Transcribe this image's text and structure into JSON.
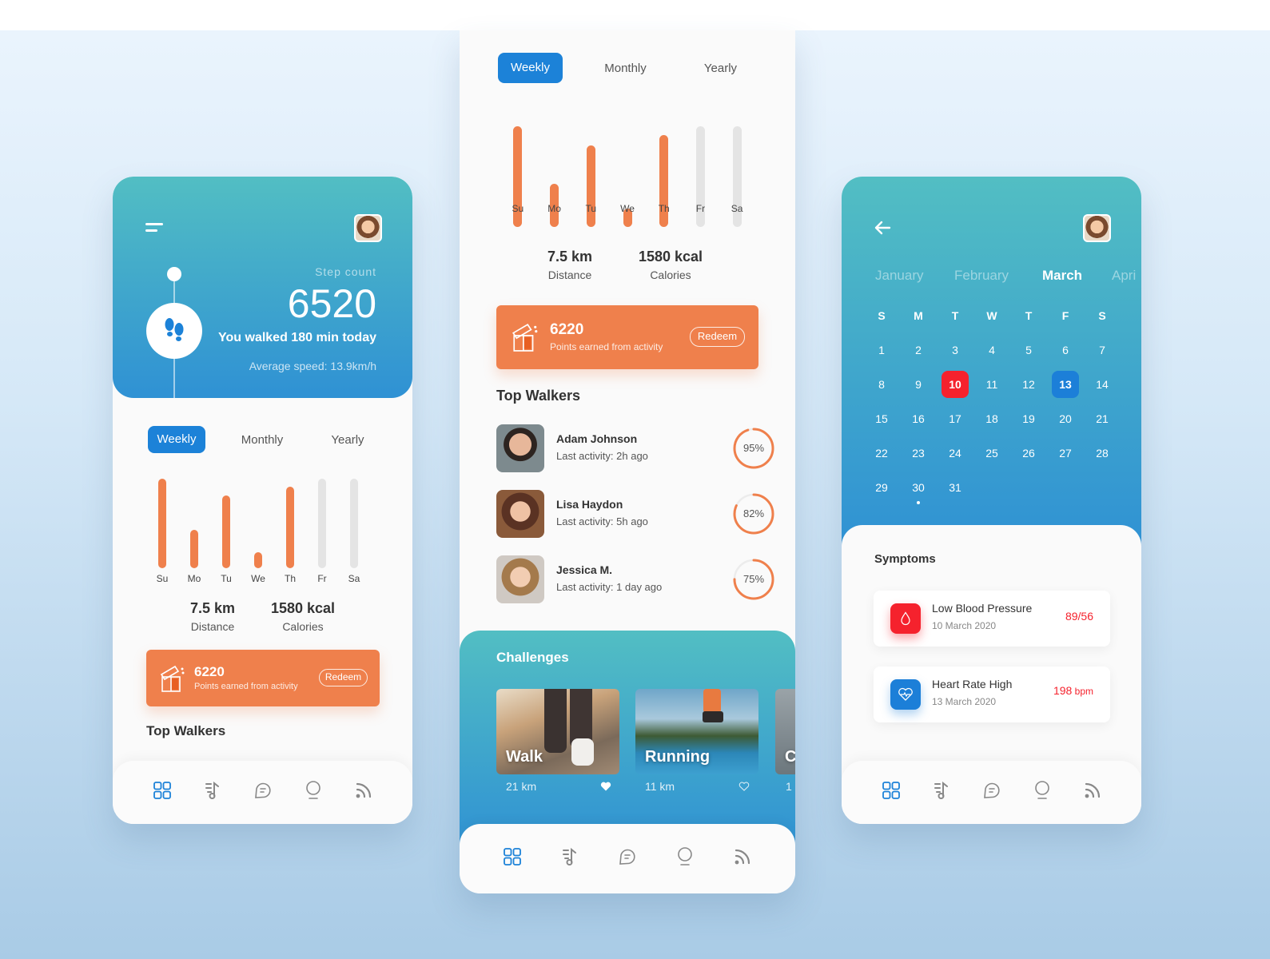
{
  "colors": {
    "accent_blue": "#1c82d8",
    "accent_orange": "#ef804c",
    "bar_inactive": "#e4e4e4",
    "alert_red": "#f5222d",
    "gradient_top": "#52bec3",
    "gradient_bottom": "#2f91d4"
  },
  "period_tabs": [
    {
      "label": "Weekly",
      "active": true
    },
    {
      "label": "Monthly",
      "active": false
    },
    {
      "label": "Yearly",
      "active": false
    }
  ],
  "weekly_activity": {
    "days": [
      "Su",
      "Mo",
      "Tu",
      "We",
      "Th",
      "Fr",
      "Sa"
    ],
    "values": [
      1.0,
      0.43,
      0.81,
      0.18,
      0.91,
      0,
      0
    ],
    "completed": [
      true,
      true,
      true,
      true,
      true,
      false,
      false
    ]
  },
  "stats": {
    "distance_value": "7.5 km",
    "distance_label": "Distance",
    "calories_value": "1580 kcal",
    "calories_label": "Calories"
  },
  "points": {
    "value": "6220",
    "label": "Points earned from activity",
    "button": "Redeem"
  },
  "step_card": {
    "label": "Step count",
    "value": "6520",
    "summary": "You walked 180 min today",
    "speed": "Average speed: 13.9km/h"
  },
  "top_walkers": {
    "title": "Top Walkers",
    "items": [
      {
        "name": "Adam Johnson",
        "activity": "Last activity: 2h ago",
        "percent": 95,
        "percent_label": "95%"
      },
      {
        "name": "Lisa Haydon",
        "activity": "Last activity: 5h ago",
        "percent": 82,
        "percent_label": "82%"
      },
      {
        "name": "Jessica M.",
        "activity": "Last activity: 1 day ago",
        "percent": 75,
        "percent_label": "75%"
      }
    ]
  },
  "challenges": {
    "title": "Challenges",
    "items": [
      {
        "name": "Walk",
        "distance": "21 km",
        "liked": true
      },
      {
        "name": "Running",
        "distance": "11 km",
        "liked": false
      },
      {
        "name": "C",
        "distance": "1",
        "liked": false
      }
    ]
  },
  "bottom_nav": [
    {
      "icon": "grid-icon",
      "active": true
    },
    {
      "icon": "music-note-icon",
      "active": false
    },
    {
      "icon": "chat-bubble-icon",
      "active": false
    },
    {
      "icon": "lightbulb-icon",
      "active": false
    },
    {
      "icon": "rss-icon",
      "active": false
    }
  ],
  "calendar": {
    "months": [
      {
        "label": "January",
        "active": false
      },
      {
        "label": "February",
        "active": false
      },
      {
        "label": "March",
        "active": true
      },
      {
        "label": "Apri",
        "active": false
      }
    ],
    "weekday_headers": [
      "S",
      "M",
      "T",
      "W",
      "T",
      "F",
      "S"
    ],
    "weeks": [
      [
        "1",
        "2",
        "3",
        "4",
        "5",
        "6",
        "7"
      ],
      [
        "8",
        "9",
        "10",
        "11",
        "12",
        "13",
        "14"
      ],
      [
        "15",
        "16",
        "17",
        "18",
        "19",
        "20",
        "21"
      ],
      [
        "22",
        "23",
        "24",
        "25",
        "26",
        "27",
        "28"
      ],
      [
        "29",
        "30",
        "31",
        "",
        "",
        "",
        ""
      ]
    ],
    "highlight_red": "10",
    "highlight_blue": "13",
    "dot_day": "30"
  },
  "symptoms": {
    "title": "Symptoms",
    "items": [
      {
        "name": "Low Blood Pressure",
        "date": "10 March 2020",
        "value": "89/56",
        "unit": "",
        "icon": "blood-drop-icon",
        "color": "#f5222d"
      },
      {
        "name": "Heart Rate High",
        "date": "13 March 2020",
        "value": "198",
        "unit": " bpm",
        "icon": "heart-rate-icon",
        "color": "#1c7fd8"
      }
    ]
  }
}
